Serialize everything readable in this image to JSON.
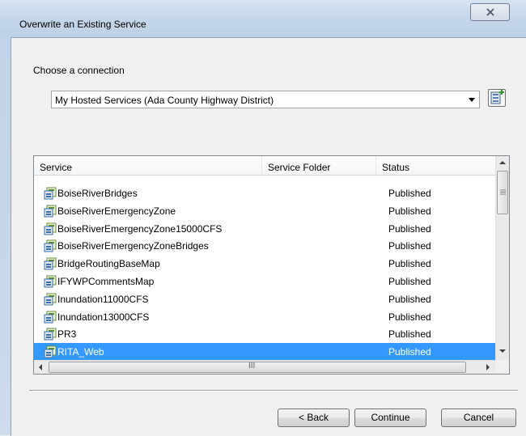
{
  "window": {
    "title": "Overwrite an Existing Service"
  },
  "connection": {
    "label": "Choose a connection",
    "selected": "My Hosted Services (Ada County Highway District)"
  },
  "table": {
    "columns": [
      "Service",
      "Service Folder",
      "Status"
    ],
    "rows": [
      {
        "service": "BoiseRiverBridges",
        "folder": "",
        "status": "Published"
      },
      {
        "service": "BoiseRiverEmergencyZone",
        "folder": "",
        "status": "Published"
      },
      {
        "service": "BoiseRiverEmergencyZone15000CFS",
        "folder": "",
        "status": "Published"
      },
      {
        "service": "BoiseRiverEmergencyZoneBridges",
        "folder": "",
        "status": "Published"
      },
      {
        "service": "BridgeRoutingBaseMap",
        "folder": "",
        "status": "Published"
      },
      {
        "service": "IFYWPCommentsMap",
        "folder": "",
        "status": "Published"
      },
      {
        "service": "Inundation11000CFS",
        "folder": "",
        "status": "Published"
      },
      {
        "service": "Inundation13000CFS",
        "folder": "",
        "status": "Published"
      },
      {
        "service": "PR3",
        "folder": "",
        "status": "Published"
      },
      {
        "service": "RITA_Web",
        "folder": "",
        "status": "Published",
        "selected": true
      }
    ],
    "scroll_glyph": "III"
  },
  "buttons": {
    "back": "< Back",
    "continue": "Continue",
    "cancel": "Cancel"
  },
  "colors": {
    "selection": "#3399ff",
    "titlebar": "#c4d6ea"
  },
  "icons": {
    "close": "close-x-icon",
    "dropdown": "chevron-down-icon",
    "add_connection": "add-server-icon",
    "service": "map-service-icon"
  }
}
